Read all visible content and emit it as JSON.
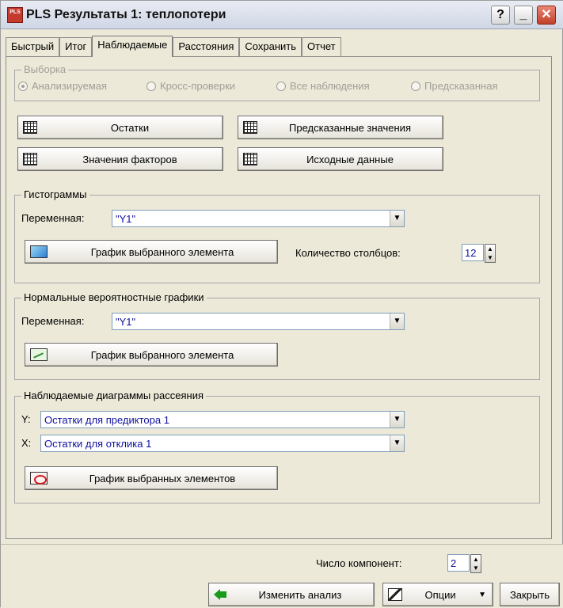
{
  "window": {
    "title": "PLS Результаты 1: теплопотери",
    "app_icon_text": "PLS",
    "help": "?",
    "minimize": "_",
    "close": "✕"
  },
  "tabs": [
    "Быстрый",
    "Итог",
    "Наблюдаемые",
    "Расстояния",
    "Сохранить",
    "Отчет"
  ],
  "active_tab": "Наблюдаемые",
  "sample": {
    "title": "Выборка",
    "options": [
      "Анализируемая",
      "Кросс-проверки",
      "Все наблюдения",
      "Предсказанная"
    ],
    "selected": "Анализируемая"
  },
  "buttons": {
    "residuals": "Остатки",
    "predicted": "Предсказанные значения",
    "factor_values": "Значения факторов",
    "source_data": "Исходные данные"
  },
  "histograms": {
    "title": "Гистограммы",
    "variable_label": "Переменная:",
    "variable_value": "\"Y1\"",
    "plot_button": "График выбранного элемента",
    "columns_label": "Количество столбцов:",
    "columns_value": "12"
  },
  "normal_plots": {
    "title": "Нормальные вероятностные графики",
    "variable_label": "Переменная:",
    "variable_value": "\"Y1\"",
    "plot_button": "График выбранного элемента"
  },
  "scatterplots": {
    "title": "Наблюдаемые диаграммы рассеяния",
    "y_label": "Y:",
    "y_value": "Остатки для предиктора 1",
    "x_label": "X:",
    "x_value": "Остатки для отклика 1",
    "plot_button": "График выбранных элементов"
  },
  "footer": {
    "components_label": "Число компонент:",
    "components_value": "2",
    "modify_button": "Изменить анализ",
    "options_button": "Опции",
    "options_arrow": "▼",
    "close_button": "Закрыть"
  },
  "icons": {
    "combo_arrow": "▼",
    "spin_up": "▲",
    "spin_down": "▼"
  }
}
